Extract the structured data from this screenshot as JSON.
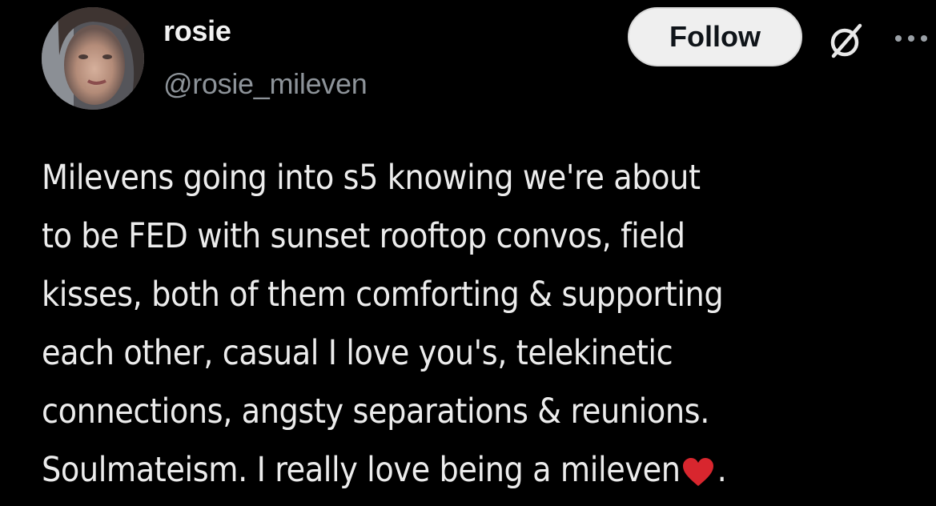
{
  "user": {
    "display_name": "rosie",
    "handle": "@rosie_mileven",
    "avatar_icon": "profile-photo"
  },
  "actions": {
    "follow_label": "Follow",
    "grok_icon": "grok-slash-circle-icon",
    "more_icon": "more-horizontal-icon"
  },
  "post": {
    "lines": [
      "Milevens going into s5 knowing we're about",
      "to be FED with sunset rooftop convos, field",
      "kisses, both of them comforting & supporting",
      "each other, casual I love you's, telekinetic",
      "connections, angsty separations & reunions."
    ],
    "last_line_text": "Soulmateism. I really love being a mileven",
    "last_line_end": ".",
    "emoji": "red-heart"
  },
  "colors": {
    "background": "#000000",
    "text": "#ececec",
    "handle": "#8d9399",
    "follow_bg": "#efefef",
    "follow_text": "#0f1419",
    "heart": "#d8262e"
  }
}
